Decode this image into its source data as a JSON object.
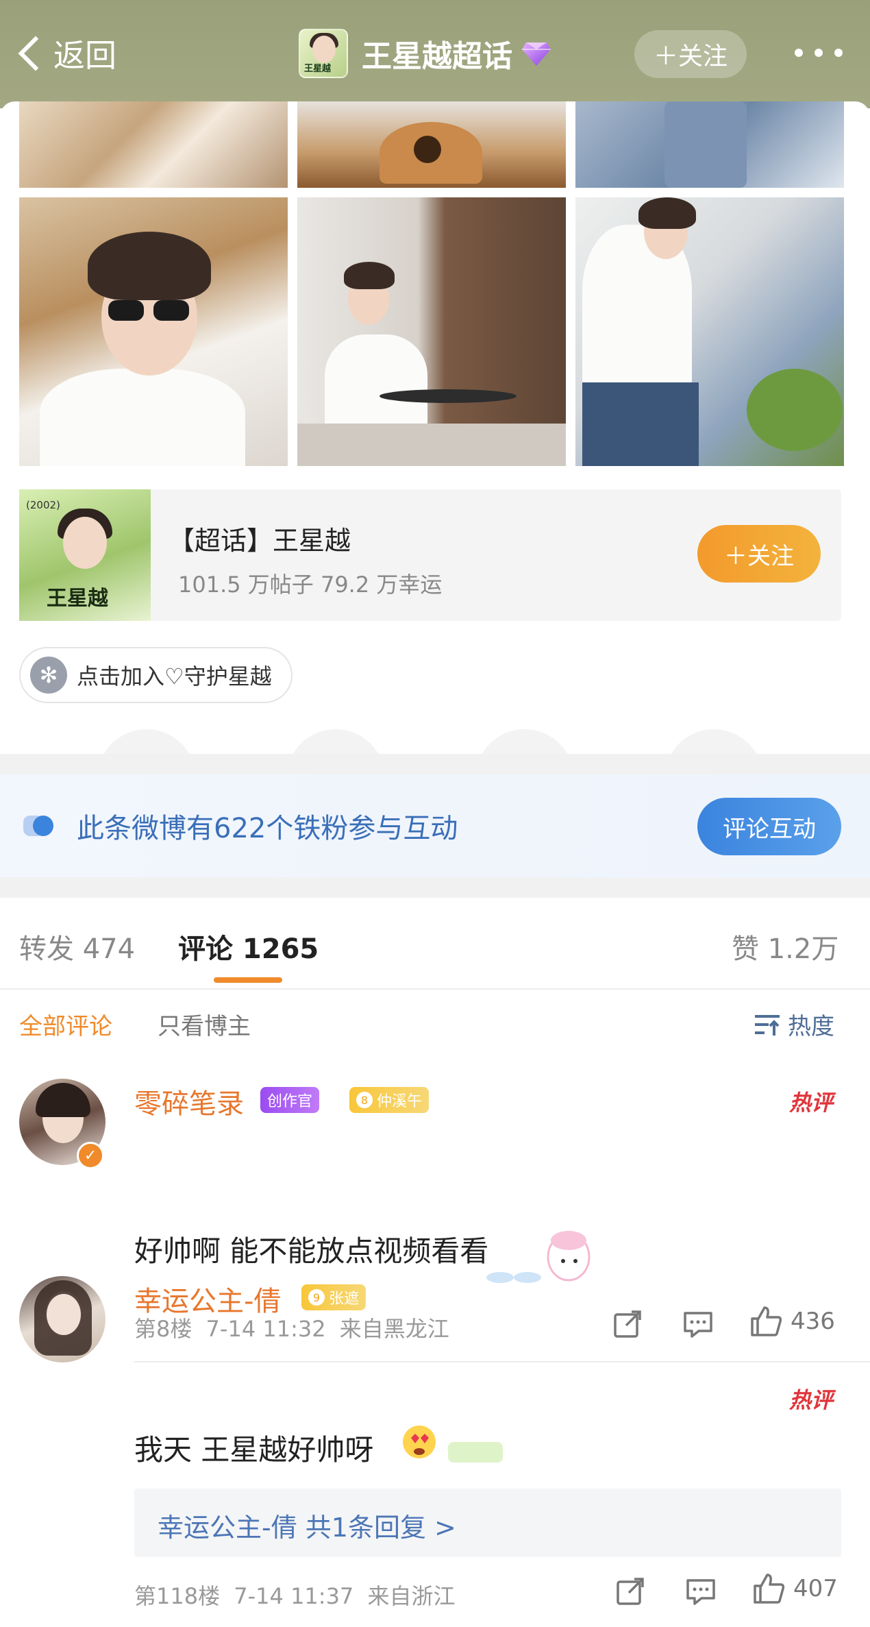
{
  "header": {
    "back_label": "返回",
    "title": "王星越超话",
    "avatar_caption": "王星越",
    "follow_label": "＋关注"
  },
  "topic_card": {
    "title": "【超话】王星越",
    "stats": "101.5 万帖子 79.2 万幸运",
    "follow_label": "＋关注",
    "image_name": "王星越",
    "image_year": "(2002)"
  },
  "guard": {
    "label": "点击加入♡守护星越"
  },
  "share": {
    "items": [
      "wechat-icon",
      "moments-icon",
      "qq-icon",
      "save-image-icon"
    ]
  },
  "fan_banner": {
    "text": "此条微博有622个铁粉参与互动",
    "button_label": "评论互动"
  },
  "tabs": {
    "repost": "转发 474",
    "comment": "评论 1265",
    "like": "赞 1.2万"
  },
  "filter": {
    "all": "全部评论",
    "owner_only": "只看博主",
    "sort": "热度"
  },
  "comments": [
    {
      "name": "零碎笔录",
      "badge_creator": "创作官",
      "badge_fan_level": "8",
      "badge_fan": "仲溪午",
      "hot": "热评",
      "text": "好帅啊 能不能放点视频看看",
      "floor": "第8楼",
      "time": "7-14 11:32",
      "location": "来自黑龙江",
      "likes": "436"
    },
    {
      "name": "幸运公主-倩",
      "badge_fan_level": "9",
      "badge_fan": "张遮",
      "hot": "热评",
      "text": "我天 王星越好帅呀",
      "reply_summary": "幸运公主-倩  共1条回复 >",
      "floor": "第118楼",
      "time": "7-14 11:37",
      "location": "来自浙江",
      "likes": "407"
    }
  ],
  "colors": {
    "header_bg": "#9aa17a",
    "accent_orange": "#f08a2a",
    "link_blue": "#4c76b6",
    "hot_red": "#e0353b"
  }
}
